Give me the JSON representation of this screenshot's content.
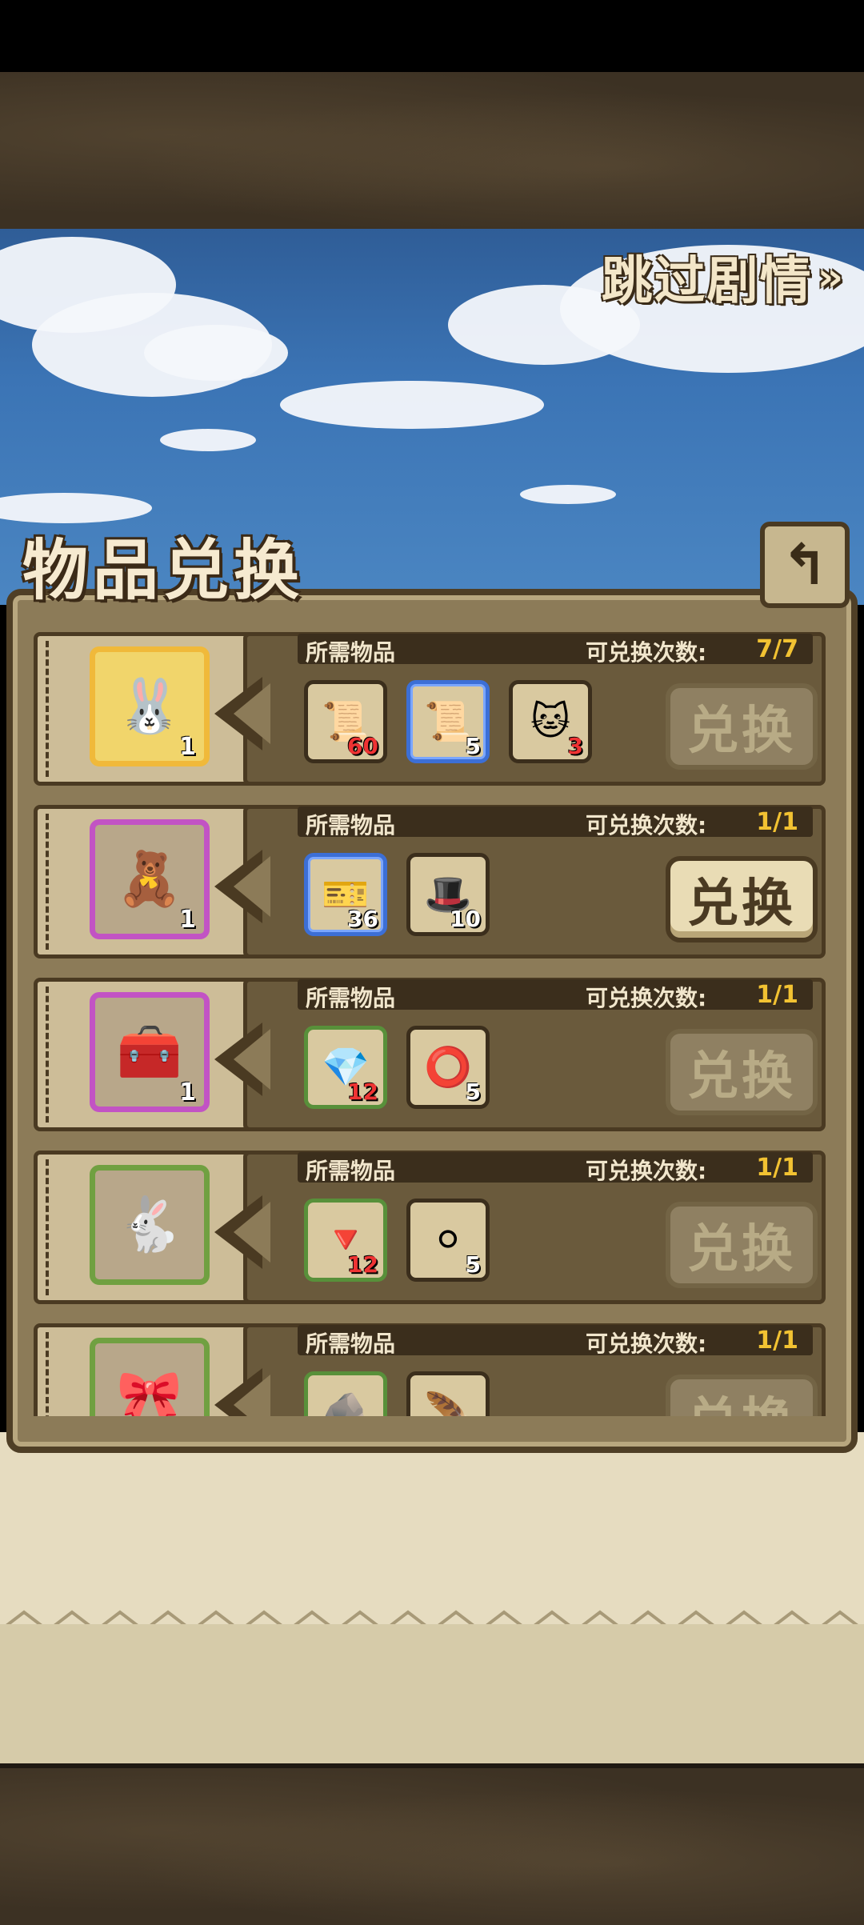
{
  "skip_story": "跳过剧情",
  "skip_icon": "double-chevron-right-icon",
  "panel_title": "物品兑换",
  "back_icon": "return-arrow-icon",
  "headers": {
    "required_items": "所需物品",
    "exchange_times_label": "可兑换次数:"
  },
  "exchange_button_label": "兑换",
  "rows": [
    {
      "reward": {
        "icon": "pink-bunny-ear-headband-icon",
        "qty": "1",
        "frame": "gold"
      },
      "count": "7/7",
      "requirements": [
        {
          "icon": "red-scroll-icon",
          "qty": "60",
          "qty_red": true,
          "frame": "normal"
        },
        {
          "icon": "blue-scroll-icon",
          "qty": "5",
          "qty_red": false,
          "frame": "blue"
        },
        {
          "icon": "cat-plush-icon",
          "qty": "3",
          "qty_red": true,
          "frame": "normal"
        }
      ],
      "button_enabled": false
    },
    {
      "reward": {
        "icon": "character-figure-icon",
        "qty": "1",
        "frame": "purple"
      },
      "count": "1/1",
      "requirements": [
        {
          "icon": "purple-ticket-icon",
          "qty": "36",
          "qty_red": false,
          "frame": "blue"
        },
        {
          "icon": "witch-hat-icon",
          "qty": "10",
          "qty_red": false,
          "frame": "normal"
        }
      ],
      "button_enabled": true
    },
    {
      "reward": {
        "icon": "red-treasure-chest-icon",
        "qty": "1",
        "frame": "purple"
      },
      "count": "1/1",
      "requirements": [
        {
          "icon": "blue-crystal-ore-icon",
          "qty": "12",
          "qty_red": true,
          "frame": "green"
        },
        {
          "icon": "gold-ring-icon",
          "qty": "5",
          "qty_red": false,
          "frame": "normal"
        }
      ],
      "button_enabled": false
    },
    {
      "reward": {
        "icon": "bunny-keychain-icon",
        "qty": "",
        "frame": "green"
      },
      "count": "1/1",
      "requirements": [
        {
          "icon": "red-crystal-ore-icon",
          "qty": "12",
          "qty_red": true,
          "frame": "green"
        },
        {
          "icon": "white-pompom-icon",
          "qty": "5",
          "qty_red": false,
          "frame": "normal"
        }
      ],
      "button_enabled": false
    },
    {
      "reward": {
        "icon": "ribbon-icon",
        "qty": "",
        "frame": "green"
      },
      "count": "1/1",
      "requirements": [
        {
          "icon": "gold-ore-icon",
          "qty": "",
          "qty_red": false,
          "frame": "green"
        },
        {
          "icon": "feather-icon",
          "qty": "",
          "qty_red": false,
          "frame": "normal"
        }
      ],
      "button_enabled": false
    }
  ]
}
